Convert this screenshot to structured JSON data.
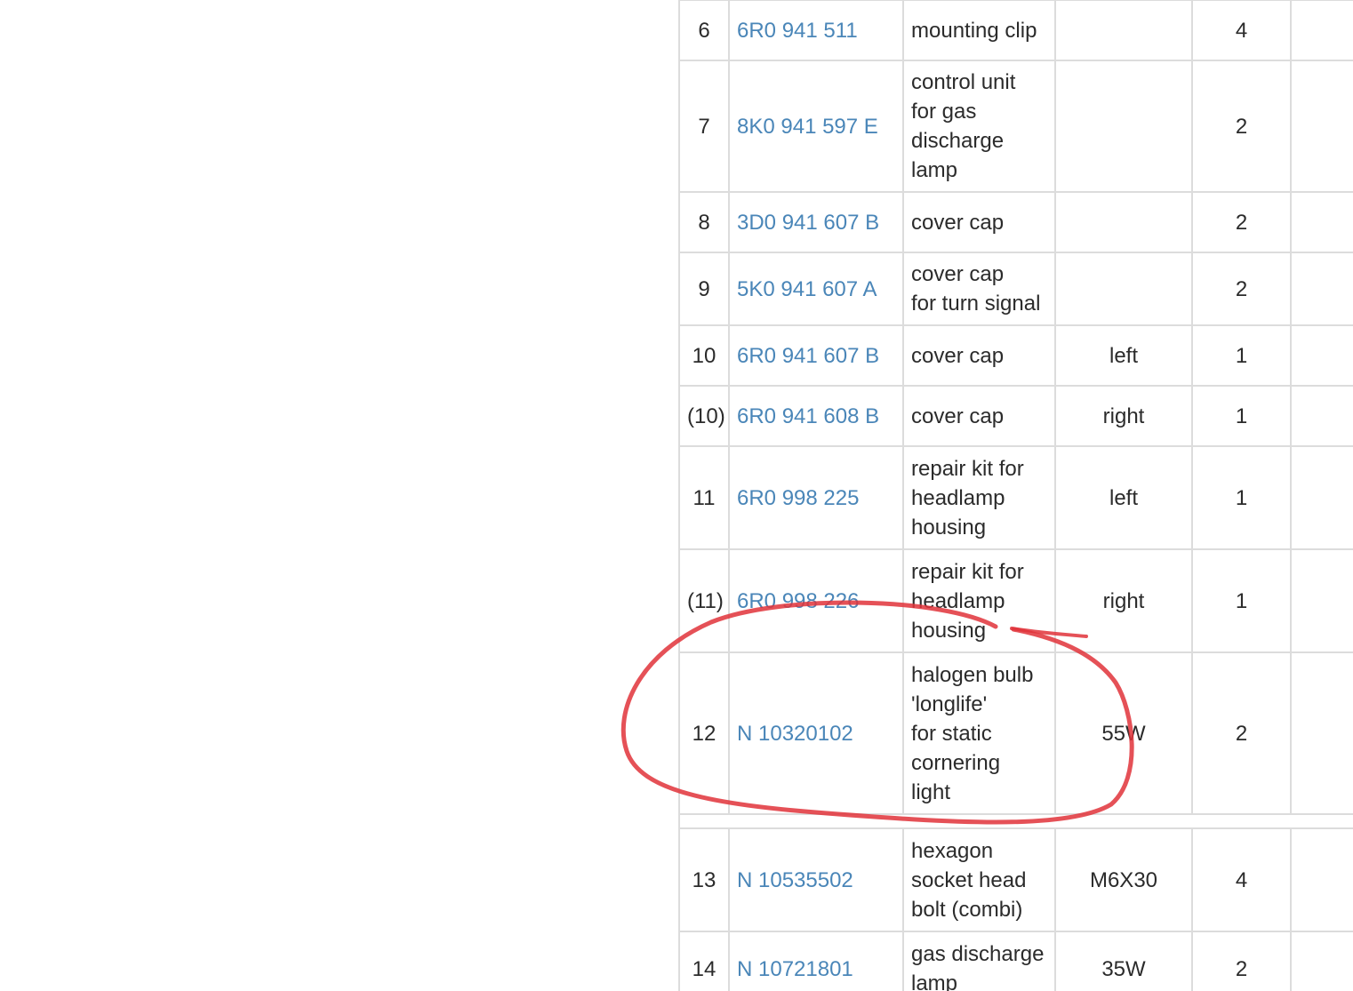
{
  "rows": [
    {
      "pos": "6",
      "part": "6R0 941 511",
      "desc": [
        "mounting clip"
      ],
      "note": "",
      "qty": "4"
    },
    {
      "pos": "7",
      "part": "8K0 941 597 E",
      "desc": [
        "control unit",
        "for gas",
        "discharge",
        "lamp"
      ],
      "note": "",
      "qty": "2"
    },
    {
      "pos": "8",
      "part": "3D0 941 607 B",
      "desc": [
        "cover cap"
      ],
      "note": "",
      "qty": "2"
    },
    {
      "pos": "9",
      "part": "5K0 941 607 A",
      "desc": [
        "cover cap",
        "for turn signal"
      ],
      "note": "",
      "qty": "2"
    },
    {
      "pos": "10",
      "part": "6R0 941 607 B",
      "desc": [
        "cover cap"
      ],
      "note": "left",
      "qty": "1"
    },
    {
      "pos": "(10)",
      "part": "6R0 941 608 B",
      "desc": [
        "cover cap"
      ],
      "note": "right",
      "qty": "1"
    },
    {
      "pos": "11",
      "part": "6R0 998 225",
      "desc": [
        "repair kit for",
        "headlamp",
        "housing"
      ],
      "note": "left",
      "qty": "1"
    },
    {
      "pos": "(11)",
      "part": "6R0 998 226",
      "desc": [
        "repair kit for",
        "headlamp",
        "housing"
      ],
      "note": "right",
      "qty": "1"
    },
    {
      "pos": "12",
      "part": "N  10320102",
      "desc": [
        "halogen bulb",
        "'longlife'",
        "for static",
        "cornering",
        "light"
      ],
      "note": "55W",
      "qty": "2"
    },
    {
      "pos": "13",
      "part": "N  10535502",
      "desc": [
        "hexagon",
        "socket head",
        "bolt (combi)"
      ],
      "note": "M6X30",
      "qty": "4"
    },
    {
      "pos": "14",
      "part": "N  10721801",
      "desc": [
        "gas discharge",
        "lamp"
      ],
      "note": "35W",
      "qty": "2"
    }
  ],
  "colors": {
    "link": "#4a86b8",
    "border": "#dcdcdc",
    "annotation": "#e0333a"
  }
}
